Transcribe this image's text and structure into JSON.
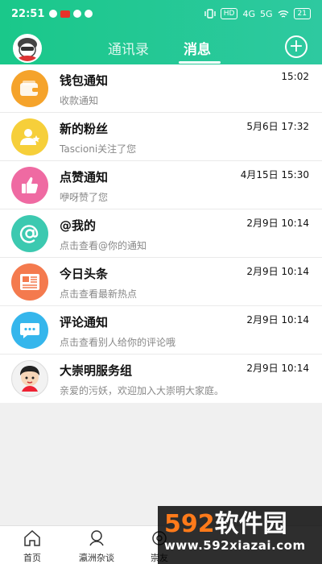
{
  "status_bar": {
    "time": "22:51",
    "net1": "HD",
    "net2": "4G",
    "net3": "5G",
    "battery": "21"
  },
  "header": {
    "tab_contacts": "通讯录",
    "tab_messages": "消息"
  },
  "messages": [
    {
      "title": "钱包通知",
      "subtitle": "收款通知",
      "time": "15:02",
      "icon": "wallet-icon",
      "color": "#f5a32b"
    },
    {
      "title": "新的粉丝",
      "subtitle": "Tascioni关注了您",
      "time": "5月6日 17:32",
      "icon": "fans-icon",
      "color": "#f6cf3a"
    },
    {
      "title": "点赞通知",
      "subtitle": "咿呀赞了您",
      "time": "4月15日 15:30",
      "icon": "thumbs-up-icon",
      "color": "#ef6aa2"
    },
    {
      "title": "@我的",
      "subtitle": "点击查看@你的通知",
      "time": "2月9日 10:14",
      "icon": "at-icon",
      "color": "#3cc9b0"
    },
    {
      "title": "今日头条",
      "subtitle": "点击查看最新热点",
      "time": "2月9日 10:14",
      "icon": "news-icon",
      "color": "#f47a4e"
    },
    {
      "title": "评论通知",
      "subtitle": "点击查看别人给你的评论哦",
      "time": "2月9日 10:14",
      "icon": "comment-icon",
      "color": "#35b6ec"
    },
    {
      "title": "大崇明服务组",
      "subtitle": "亲爱的污妖，欢迎加入大崇明大家庭。",
      "time": "2月9日 10:14",
      "icon": "service-avatar-icon",
      "color": "#f2f2f2"
    }
  ],
  "bottom_nav": {
    "home": "首页",
    "yingzhou": "瀛洲杂谈",
    "chongyou": "崇友"
  },
  "watermark": {
    "brand_num": "592",
    "brand_text": "软件园",
    "url": "www.592xiazai.com"
  }
}
